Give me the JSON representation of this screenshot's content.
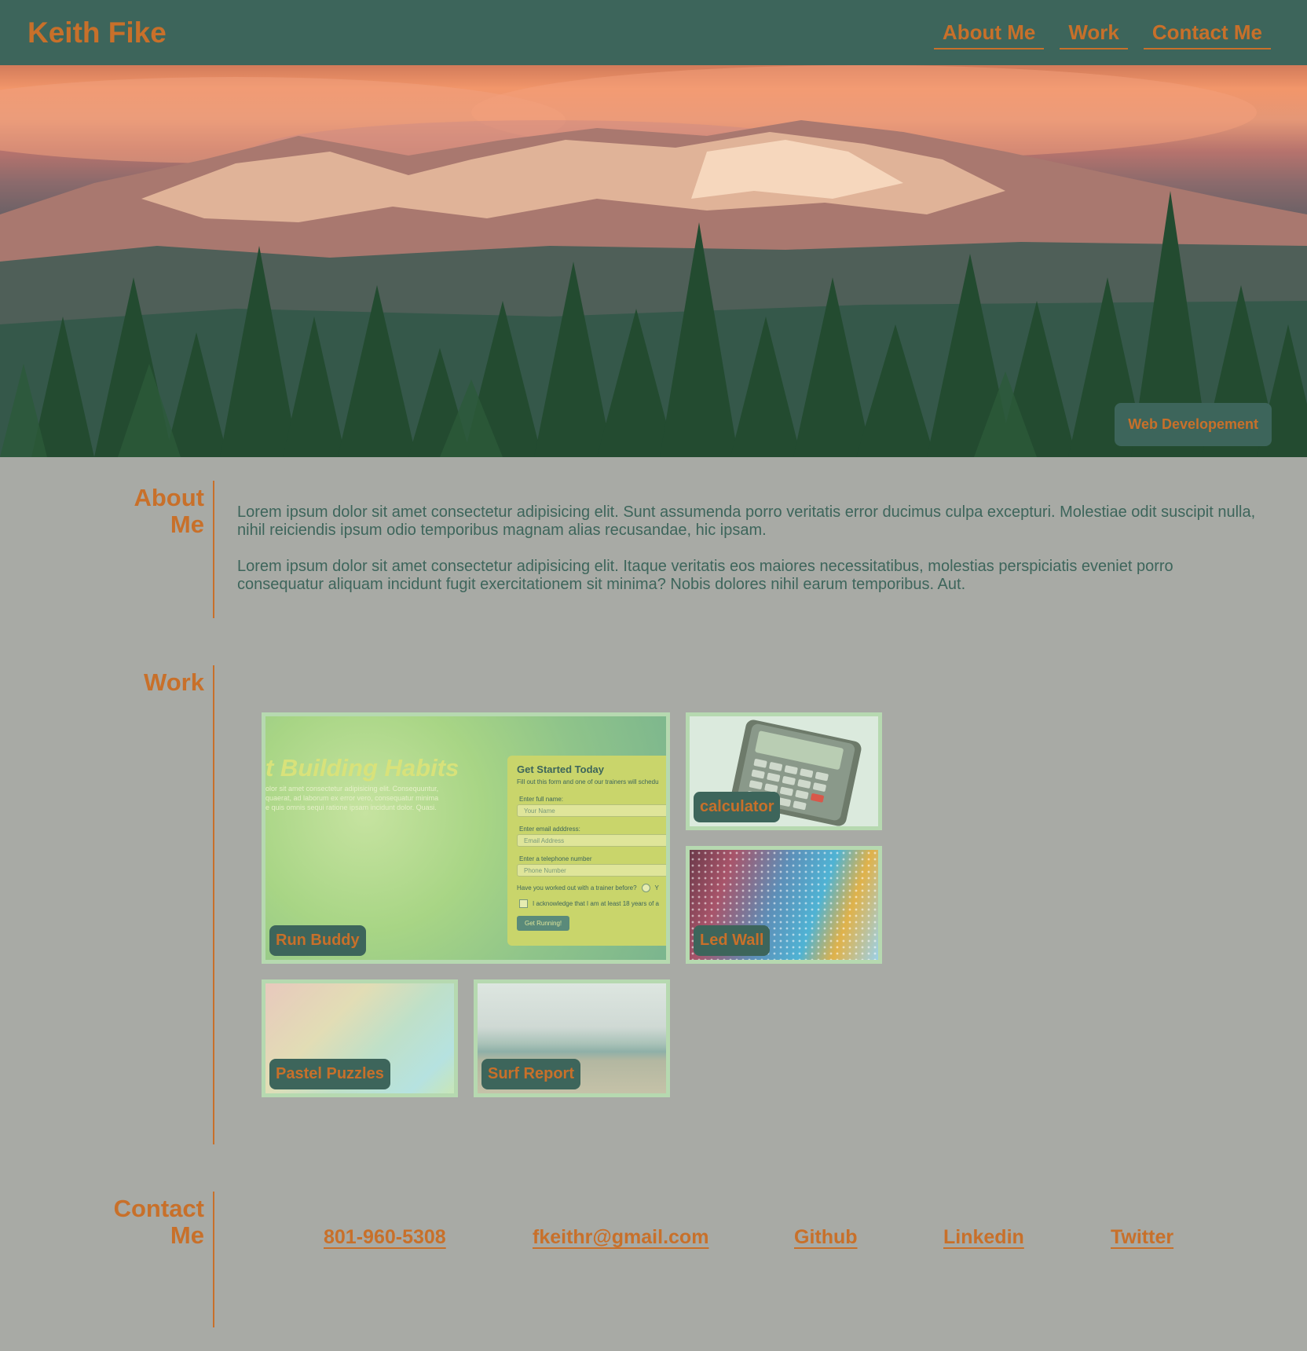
{
  "header": {
    "site_title": "Keith Fike",
    "nav": [
      "About Me",
      "Work",
      "Contact Me"
    ]
  },
  "hero": {
    "badge": "Web Developement"
  },
  "about": {
    "heading_line1": "About",
    "heading_line2": "Me",
    "paragraphs": [
      "Lorem ipsum dolor sit amet consectetur adipisicing elit. Sunt assumenda porro veritatis error ducimus culpa excepturi. Molestiae odit suscipit nulla, nihil reiciendis ipsum odio temporibus magnam alias recusandae, hic ipsam.",
      "Lorem ipsum dolor sit amet consectetur adipisicing elit. Itaque veritatis eos maiores necessitatibus, molestias perspiciatis eveniet porro consequatur aliquam incidunt fugit exercitationem sit minima? Nobis dolores nihil earum temporibus. Aut."
    ]
  },
  "work": {
    "heading": "Work",
    "projects": [
      {
        "label": "Run Buddy"
      },
      {
        "label": "calculator"
      },
      {
        "label": "Led Wall"
      },
      {
        "label": "Pastel Puzzles"
      },
      {
        "label": "Surf Report"
      }
    ],
    "run_buddy_preview": {
      "headline": "t Building Habits",
      "body_lines": [
        "olor sit amet consectetur adipisicing elit. Consequuntur,",
        "quaerat, ad laborum ex error vero, consequatur minima",
        "e quis omnis sequi ratione ipsam incidunt dolor. Quasi."
      ],
      "form_title": "Get Started Today",
      "form_subtitle": "Fill out this form and one of our trainers will schedu",
      "name_label": "Enter full name:",
      "name_placeholder": "Your Name",
      "email_label": "Enter email adddress:",
      "email_placeholder": "Email Address",
      "phone_label": "Enter a telephone number",
      "phone_placeholder": "Phone Number",
      "trainer_question": "Have you worked out with a trainer before?",
      "radio_fragment": "Y",
      "acknowledge": "I acknowledge that I am at least 18 years of a",
      "submit": "Get Running!"
    }
  },
  "contact": {
    "heading_line1": "Contact",
    "heading_line2": "Me",
    "links": [
      "801-960-5308",
      "fkeithr@gmail.com",
      "Github",
      "Linkedin",
      "Twitter"
    ]
  }
}
